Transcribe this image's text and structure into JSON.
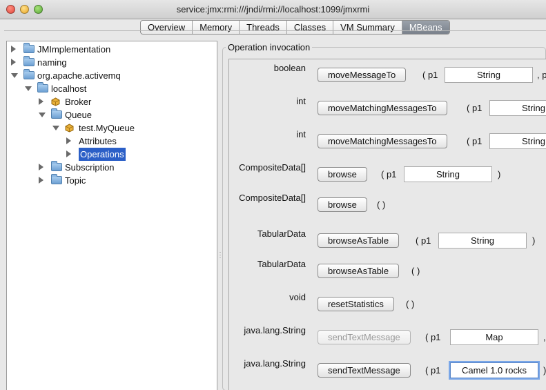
{
  "window": {
    "title": "service:jmx:rmi:///jndi/rmi://localhost:1099/jmxrmi"
  },
  "tabs": [
    {
      "label": "Overview"
    },
    {
      "label": "Memory"
    },
    {
      "label": "Threads"
    },
    {
      "label": "Classes"
    },
    {
      "label": "VM Summary"
    },
    {
      "label": "MBeans",
      "active": true
    }
  ],
  "tree": {
    "nodes": [
      {
        "label": "JMImplementation",
        "icon": "folder-icon",
        "state": "collapsed"
      },
      {
        "label": "naming",
        "icon": "folder-icon",
        "state": "collapsed"
      },
      {
        "label": "org.apache.activemq",
        "icon": "folder-icon",
        "state": "expanded"
      },
      {
        "label": "localhost",
        "icon": "folder-icon",
        "state": "expanded"
      },
      {
        "label": "Broker",
        "icon": "bean-icon",
        "state": "collapsed"
      },
      {
        "label": "Queue",
        "icon": "folder-icon",
        "state": "expanded"
      },
      {
        "label": "test.MyQueue",
        "icon": "bean-icon",
        "state": "expanded"
      },
      {
        "label": "Attributes",
        "icon": "none",
        "state": "collapsed"
      },
      {
        "label": "Operations",
        "icon": "none",
        "state": "collapsed",
        "selected": true
      },
      {
        "label": "Subscription",
        "icon": "folder-icon",
        "state": "collapsed"
      },
      {
        "label": "Topic",
        "icon": "folder-icon",
        "state": "collapsed"
      }
    ]
  },
  "panel": {
    "legend": "Operation invocation",
    "param_open": "( p1",
    "empty_params": "( )",
    "close_paren": ")",
    "comma": ",",
    "comma_p": ", p",
    "operations": [
      {
        "return_type": "boolean",
        "name": "moveMessageTo",
        "param": "String",
        "after": ", p"
      },
      {
        "return_type": "int",
        "name": "moveMatchingMessagesTo",
        "param": "String",
        "after": ""
      },
      {
        "return_type": "int",
        "name": "moveMatchingMessagesTo",
        "param": "String",
        "after": ""
      },
      {
        "return_type": "CompositeData[]",
        "name": "browse",
        "param": "String",
        "after": ")"
      },
      {
        "return_type": "CompositeData[]",
        "name": "browse",
        "param": null,
        "after": ""
      },
      {
        "return_type": "TabularData",
        "name": "browseAsTable",
        "param": "String",
        "after": ")"
      },
      {
        "return_type": "TabularData",
        "name": "browseAsTable",
        "param": null,
        "after": ""
      },
      {
        "return_type": "void",
        "name": "resetStatistics",
        "param": null,
        "after": ""
      },
      {
        "return_type": "java.lang.String",
        "name": "sendTextMessage",
        "param": "Map",
        "after": ",",
        "disabled": true
      },
      {
        "return_type": "java.lang.String",
        "name": "sendTextMessage",
        "param": "Camel 1.0 rocks",
        "after": ")",
        "focused": true
      }
    ]
  },
  "colors": {
    "selection": "#2b5fc7",
    "active_tab": "#7a818b"
  }
}
